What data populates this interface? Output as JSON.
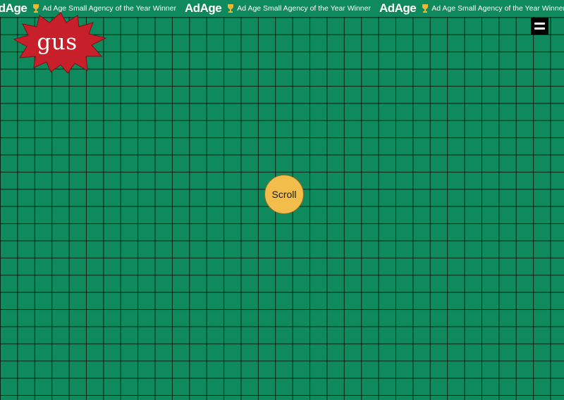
{
  "header": {
    "brand": "AdAge",
    "award_text": "Ad Age Small Agency of the Year Winner"
  },
  "logo": {
    "text": "gus"
  },
  "menu": {
    "icon": "hamburger-icon"
  },
  "scroll_button": {
    "label": "Scroll"
  },
  "colors": {
    "background": "#0e8a5c",
    "grid_lines": "#000000",
    "logo_burst": "#c8202a",
    "scroll_button": "#f2bd4b",
    "menu_button": "#000000"
  }
}
